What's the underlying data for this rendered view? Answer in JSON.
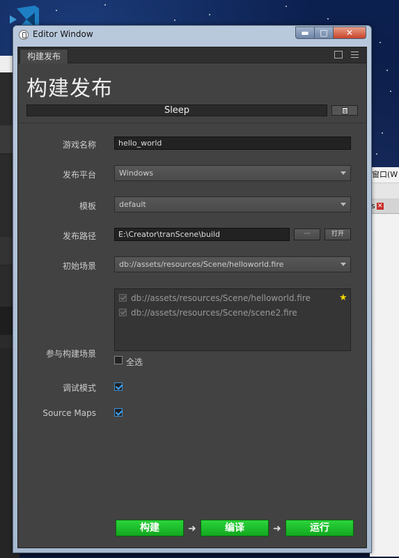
{
  "window": {
    "title": "Editor Window",
    "controls": {
      "minimize": "▬",
      "maximize": "□",
      "close": "✕"
    }
  },
  "background": {
    "right_menu": "窗口(W",
    "right_tab": "s"
  },
  "panel": {
    "tab_label": "构建发布",
    "heading": "构建发布",
    "progress_text": "Sleep"
  },
  "form": {
    "game_name_label": "游戏名称",
    "game_name_value": "hello_world",
    "platform_label": "发布平台",
    "platform_value": "Windows",
    "template_label": "模板",
    "template_value": "default",
    "path_label": "发布路径",
    "path_value": "E:\\Creator\\tranScene\\build",
    "path_browse": "···",
    "path_open": "打开",
    "start_scene_label": "初始场景",
    "start_scene_value": "db://assets/resources/Scene/helloworld.fire",
    "scenes_label": "参与构建场景",
    "scenes": [
      "db://assets/resources/Scene/helloworld.fire",
      "db://assets/resources/Scene/scene2.fire"
    ],
    "select_all": "全选",
    "debug_label": "调试模式",
    "sourcemaps_label": "Source Maps"
  },
  "actions": {
    "build": "构建",
    "compile": "编译",
    "run": "运行",
    "arrow": "➜"
  },
  "colors": {
    "action_green": "#1cc42b",
    "panel_bg": "#424242",
    "checkbox_blue": "#3ea6ff",
    "star_yellow": "#f5d800"
  }
}
